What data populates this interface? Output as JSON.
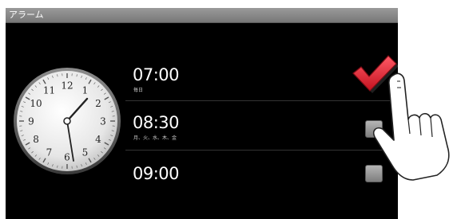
{
  "app": {
    "title": "アラーム"
  },
  "clock": {
    "numbers": [
      "12",
      "1",
      "2",
      "3",
      "4",
      "5",
      "6",
      "7",
      "8",
      "9",
      "10",
      "11"
    ]
  },
  "alarms": [
    {
      "time": "07:00",
      "days": "毎日",
      "enabled": true
    },
    {
      "time": "08:30",
      "days": "月、火、水、木、金",
      "enabled": false
    },
    {
      "time": "09:00",
      "days": "",
      "enabled": false
    }
  ],
  "colors": {
    "background": "#000000",
    "titlebar": "#8a8a8a",
    "check_red": "#e02030",
    "checkbox_gray": "#9a9a9a"
  },
  "icons": {
    "clock": "analog-clock-icon",
    "check": "checkmark-icon",
    "hand": "pointing-hand-icon"
  }
}
